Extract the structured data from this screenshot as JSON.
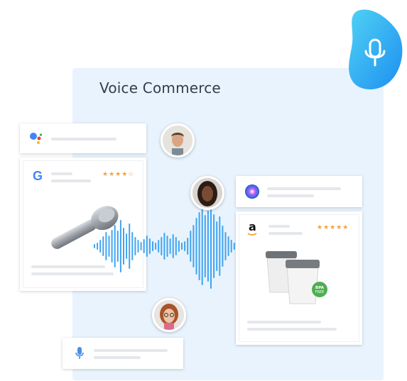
{
  "panel": {
    "title": "Voice Commerce"
  },
  "colors": {
    "panel_bg": "#e8f3fd",
    "accent_blue": "#2f9cf0",
    "wave_blue": "#3fa4f0",
    "star": "#f2a23a",
    "bpa_badge": "#4caf50"
  },
  "cards": {
    "assistant": {
      "icon": "google-assistant-icon"
    },
    "google_product": {
      "brand_icon": "google-g-icon",
      "brand_letter": "G",
      "rating": 4,
      "stars_text": "★★★★☆",
      "product": "ice-cream-scoop"
    },
    "siri": {
      "icon": "siri-icon"
    },
    "amazon_product": {
      "brand_icon": "amazon-icon",
      "brand_letter": "a",
      "rating": 5,
      "stars_text": "★★★★★",
      "product": "ice-cream-containers",
      "badge": {
        "line1": "BPA",
        "line2": "FREE"
      }
    },
    "mic_input": {
      "icon": "microphone-icon"
    }
  },
  "floating_button": {
    "icon": "microphone-icon"
  }
}
